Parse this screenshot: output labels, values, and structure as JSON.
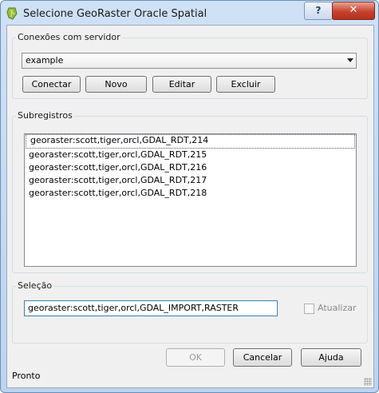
{
  "window": {
    "title": "Selecione GeoRaster Oracle Spatial",
    "help_label": "?",
    "close_label": "✕",
    "icon": "qgis-logo-icon"
  },
  "connections": {
    "group_title": "Conexões com servidor",
    "selected": "example",
    "buttons": {
      "connect": "Conectar",
      "new": "Novo",
      "edit": "Editar",
      "delete": "Excluir"
    }
  },
  "subdatasets": {
    "group_title": "Subregistros",
    "items": [
      "georaster:scott,tiger,orcl,GDAL_RDT,214",
      "georaster:scott,tiger,orcl,GDAL_RDT,215",
      "georaster:scott,tiger,orcl,GDAL_RDT,216",
      "georaster:scott,tiger,orcl,GDAL_RDT,217",
      "georaster:scott,tiger,orcl,GDAL_RDT,218"
    ]
  },
  "selection": {
    "group_title": "Seleção",
    "value": "georaster:scott,tiger,orcl,GDAL_IMPORT,RASTER",
    "refresh_label": "Atualizar",
    "refresh_checked": false
  },
  "footer": {
    "ok": "OK",
    "cancel": "Cancelar",
    "help": "Ajuda"
  },
  "status": "Pronto"
}
